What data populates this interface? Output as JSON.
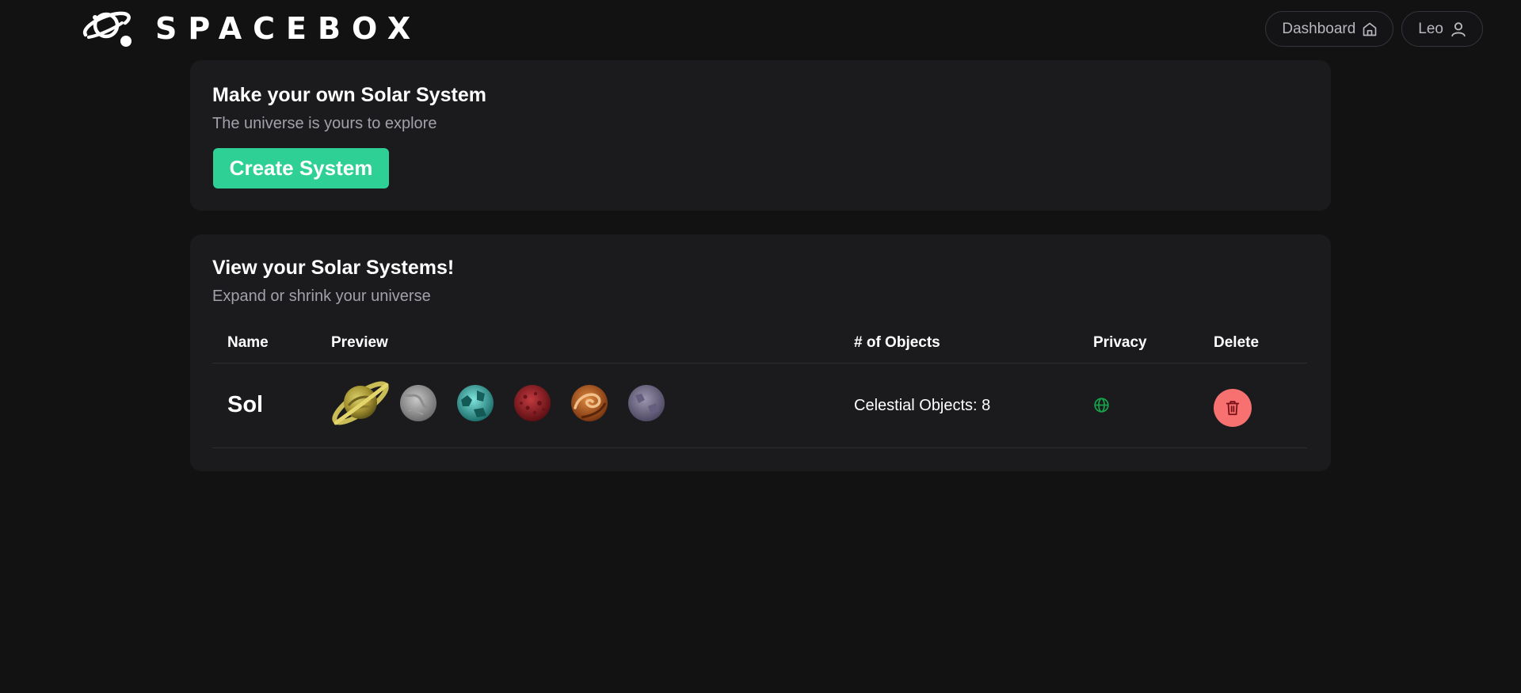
{
  "header": {
    "brand": "SPACEBOX",
    "nav": [
      {
        "label": "Dashboard",
        "icon": "home-icon"
      },
      {
        "label": "Leo",
        "icon": "user-icon"
      }
    ]
  },
  "create_card": {
    "title": "Make your own Solar System",
    "subtitle": "The universe is yours to explore",
    "button_label": "Create System"
  },
  "list_card": {
    "title": "View your Solar Systems!",
    "subtitle": "Expand or shrink your universe",
    "columns": [
      "Name",
      "Preview",
      "# of Objects",
      "Privacy",
      "Delete"
    ],
    "rows": [
      {
        "name": "Sol",
        "preview": [
          "saturn-planet-icon",
          "grey-planet-icon",
          "teal-planet-icon",
          "red-planet-icon",
          "swirl-planet-icon",
          "lavender-planet-icon"
        ],
        "objects": "Celestial Objects: 8",
        "privacy": "globe-icon"
      }
    ]
  },
  "colors": {
    "background": "#121213",
    "card": "#1b1b1e",
    "accent": "#2fd095",
    "danger": "#f87171",
    "public": "#16a34a"
  }
}
